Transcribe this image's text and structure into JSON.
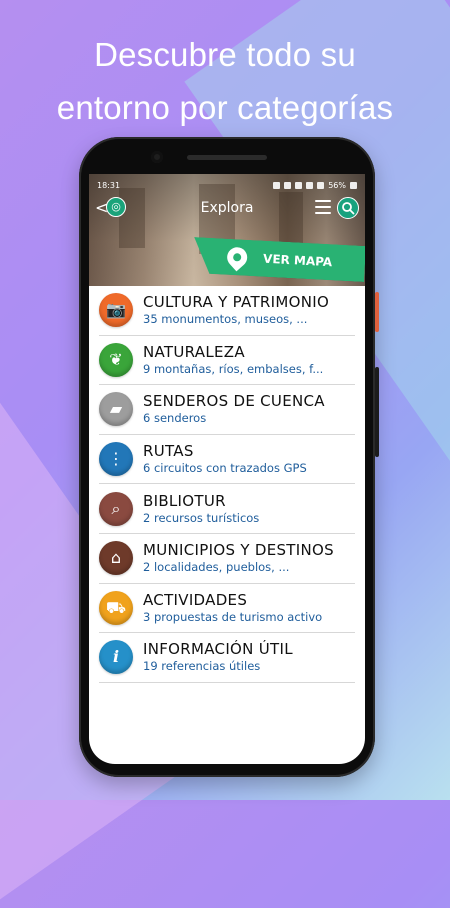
{
  "headline": {
    "line1": "Descubre todo su",
    "line2": "entorno por categorías"
  },
  "status_bar": {
    "time": "18:31",
    "battery": "56%"
  },
  "app_bar": {
    "title": "Explora",
    "back_glyph": "<"
  },
  "map_button": {
    "label": "VER MAPA",
    "color": "#29b273"
  },
  "categories": [
    {
      "title": "CULTURA Y PATRIMONIO",
      "subtitle": "35 monumentos, museos, ...",
      "icon": "camera-icon",
      "color": "#ef6a2a"
    },
    {
      "title": "NATURALEZA",
      "subtitle": "9  montañas, ríos, embalses, f...",
      "icon": "leaf-icon",
      "color": "#3aa53a"
    },
    {
      "title": "SENDEROS DE CUENCA",
      "subtitle": "6 senderos",
      "icon": "trail-map-icon",
      "color": "#9d9d9d"
    },
    {
      "title": "RUTAS",
      "subtitle": "6 circuitos con trazados GPS",
      "icon": "route-icon",
      "color": "#2277b8"
    },
    {
      "title": "BIBLIOTUR",
      "subtitle": "2 recursos turísticos",
      "icon": "book-search-icon",
      "color": "#8a4a40"
    },
    {
      "title": "MUNICIPIOS Y DESTINOS",
      "subtitle": "2 localidades, pueblos, ...",
      "icon": "house-icon",
      "color": "#6e3a2a"
    },
    {
      "title": "ACTIVIDADES",
      "subtitle": "3 propuestas de turismo activo",
      "icon": "car-icon",
      "color": "#f0a21c"
    },
    {
      "title": "INFORMACIÓN ÚTIL",
      "subtitle": "19 referencias útiles",
      "icon": "info-icon",
      "color": "#2590c9"
    }
  ]
}
